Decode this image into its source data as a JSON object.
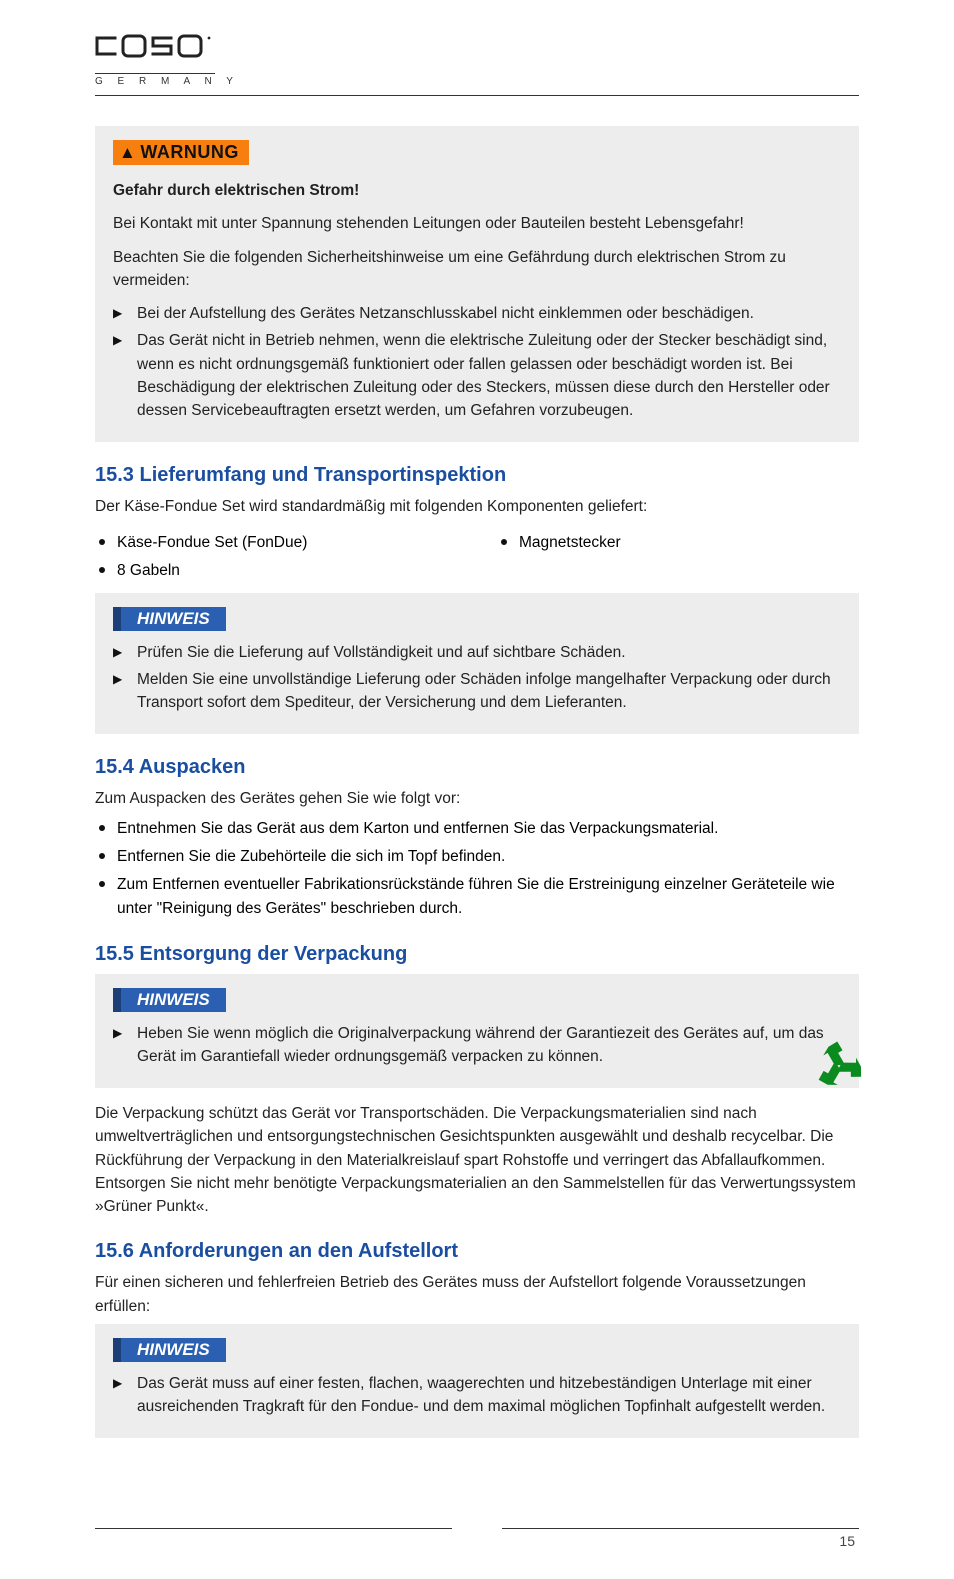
{
  "logo": {
    "brand": "caso",
    "subline": "G E R M A N Y"
  },
  "box_warnung": {
    "badge": "WARNUNG",
    "heading": "Gefahr durch elektrischen Strom!",
    "p1": "Bei Kontakt mit unter Spannung stehenden Leitungen oder Bauteilen besteht Lebensgefahr!",
    "p2": "Beachten Sie die folgenden Sicherheitshinweise um eine Gefährdung durch elektrischen Strom zu vermeiden:",
    "items": [
      "Bei der Aufstellung des Gerätes Netzanschlusskabel nicht einklemmen oder beschädigen.",
      "Das Gerät nicht in Betrieb nehmen, wenn die elektrische Zuleitung oder der Stecker beschädigt sind, wenn es nicht ordnungsgemäß funktioniert oder fallen gelassen oder beschädigt worden ist. Bei Beschädigung der elektrischen Zuleitung oder des Steckers, müssen diese durch den Hersteller oder dessen Servicebeauftragten ersetzt werden, um Gefahren vorzubeugen."
    ]
  },
  "section_lieferumfang": {
    "title": "15.3 Lieferumfang und Transportinspektion",
    "intro": "Der Käse-Fondue Set wird standardmäßig mit folgenden Komponenten geliefert:",
    "items_left": [
      "Käse-Fondue Set (FonDue)",
      "8 Gabeln"
    ],
    "items_right": [
      "Magnetstecker"
    ],
    "box": {
      "badge": "HINWEIS",
      "items": [
        "Prüfen Sie die Lieferung auf Vollständigkeit und auf sichtbare Schäden.",
        "Melden Sie eine unvollständige Lieferung oder Schäden infolge mangelhafter Verpackung oder durch Transport sofort dem Spediteur, der Versicherung und dem Lieferanten."
      ]
    }
  },
  "section_auspacken": {
    "title": "15.4 Auspacken",
    "intro": "Zum Auspacken des Gerätes gehen Sie wie folgt vor:",
    "items": [
      "Entnehmen Sie das Gerät aus dem Karton und entfernen Sie das Verpackungsmaterial.",
      "Entfernen Sie die Zubehörteile die sich im Topf befinden.",
      "Zum Entfernen eventueller Fabrikationsrückstände führen Sie die Erstreinigung einzelner Geräteteile wie unter \"Reinigung des Gerätes\" beschrieben durch."
    ]
  },
  "section_entsorgung": {
    "title": "15.5 Entsorgung der Verpackung",
    "box": {
      "badge": "HINWEIS",
      "items": [
        "Heben Sie wenn möglich die Originalverpackung während der Garantiezeit des Gerätes auf, um das Gerät im Garantiefall wieder ordnungsgemäß verpacken zu können."
      ]
    },
    "p1": "Die Verpackung schützt das Gerät vor Transportschäden. Die Verpackungsmaterialien sind nach umweltverträglichen und entsorgungstechnischen Gesichtspunkten ausgewählt und deshalb recycelbar. Die Rückführung der Verpackung in den Materialkreislauf spart Rohstoffe und verringert das Abfallaufkommen. Entsorgen Sie nicht mehr benötigte Verpackungsmaterialien an den Sammelstellen für das Verwertungssystem »Grüner Punkt«."
  },
  "section_anforderungen": {
    "title": "15.6 Anforderungen an den Aufstellort",
    "intro": "Für einen sicheren und fehlerfreien Betrieb des Gerätes muss der Aufstellort folgende Voraussetzungen erfüllen:"
  },
  "box_last": {
    "badge": "HINWEIS",
    "items": [
      "Das Gerät muss auf einer festen, flachen, waagerechten und hitzebeständigen Unterlage mit einer ausreichenden Tragkraft für den Fondue- und dem maximal möglichen Topfinhalt aufgestellt werden."
    ]
  },
  "page_number": "15"
}
